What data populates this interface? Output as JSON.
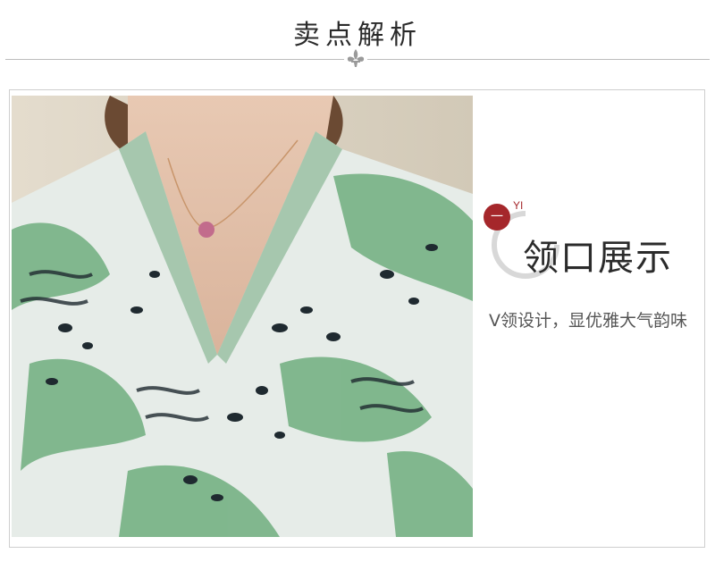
{
  "header": {
    "title": "卖点解析",
    "ornament": "fleur-de-lis-icon"
  },
  "photo": {
    "subject": "photo-neckline"
  },
  "feature": {
    "badge_char": "一",
    "badge_sub": "YI",
    "title": "领口展示",
    "description": "V领设计，显优雅大气韵味"
  },
  "colors": {
    "accent": "#a5272b",
    "divider": "#bdbdbd",
    "print_green": "#6fae7e",
    "print_dark": "#1f2a30"
  }
}
